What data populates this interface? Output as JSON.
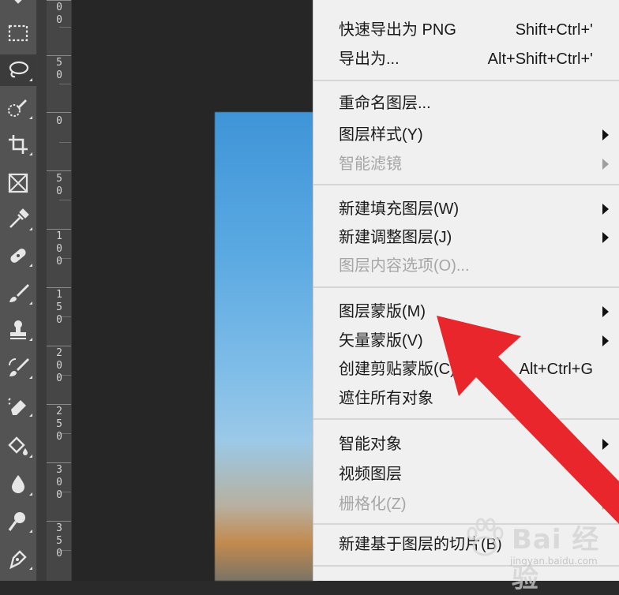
{
  "toolbar": {
    "tools": [
      {
        "icon": "move-icon"
      },
      {
        "icon": "rectangular-marquee-icon"
      },
      {
        "icon": "lasso-icon"
      },
      {
        "icon": "quick-selection-icon"
      },
      {
        "icon": "crop-icon"
      },
      {
        "icon": "frame-icon"
      },
      {
        "icon": "eyedropper-icon"
      },
      {
        "icon": "healing-brush-icon"
      },
      {
        "icon": "brush-icon"
      },
      {
        "icon": "clone-stamp-icon"
      },
      {
        "icon": "history-brush-icon"
      },
      {
        "icon": "eraser-icon"
      },
      {
        "icon": "paint-bucket-icon"
      },
      {
        "icon": "blur-icon"
      },
      {
        "icon": "dodge-icon"
      },
      {
        "icon": "pen-icon"
      }
    ],
    "active_tool": "lasso-icon"
  },
  "ruler": {
    "labels": [
      "0",
      "5\n0",
      "0",
      "5\n0",
      "1\n0\n0",
      "1\n5\n0",
      "2\n0\n0",
      "2\n5\n0",
      "3\n0\n0",
      "3\n5\n0"
    ],
    "top_partial": "0\n0"
  },
  "menu": {
    "items": [
      {
        "label": "快速导出为 PNG",
        "shortcut": "Shift+Ctrl+'",
        "enabled": true,
        "submenu": false
      },
      {
        "label": "导出为...",
        "shortcut": "Alt+Shift+Ctrl+'",
        "enabled": true,
        "submenu": false
      },
      {
        "label": "重命名图层...",
        "shortcut": "",
        "enabled": true,
        "submenu": false
      },
      {
        "label": "图层样式(Y)",
        "shortcut": "",
        "enabled": true,
        "submenu": true
      },
      {
        "label": "智能滤镜",
        "shortcut": "",
        "enabled": false,
        "submenu": true
      },
      {
        "label": "新建填充图层(W)",
        "shortcut": "",
        "enabled": true,
        "submenu": true
      },
      {
        "label": "新建调整图层(J)",
        "shortcut": "",
        "enabled": true,
        "submenu": true
      },
      {
        "label": "图层内容选项(O)...",
        "shortcut": "",
        "enabled": false,
        "submenu": false
      },
      {
        "label": "图层蒙版(M)",
        "shortcut": "",
        "enabled": true,
        "submenu": true
      },
      {
        "label": "矢量蒙版(V)",
        "shortcut": "",
        "enabled": true,
        "submenu": true
      },
      {
        "label": "创建剪贴蒙版(C)",
        "shortcut": "Alt+Ctrl+G",
        "enabled": true,
        "submenu": false
      },
      {
        "label": "遮住所有对象",
        "shortcut": "",
        "enabled": true,
        "submenu": false
      },
      {
        "label": "智能对象",
        "shortcut": "",
        "enabled": true,
        "submenu": true
      },
      {
        "label": "视频图层",
        "shortcut": "",
        "enabled": true,
        "submenu": true
      },
      {
        "label": "栅格化(Z)",
        "shortcut": "",
        "enabled": false,
        "submenu": true
      },
      {
        "label": "新建基于图层的切片(B)",
        "shortcut": "",
        "enabled": true,
        "submenu": false
      }
    ]
  },
  "annotation": {
    "arrow_color": "#e8262b",
    "points_to": "图层蒙版(M)"
  },
  "watermark": {
    "text": "Bai 经验",
    "sub": "jingyan.baidu.com"
  },
  "colors": {
    "toolbar_bg": "#535353",
    "ruler_bg": "#464646",
    "workspace_bg": "#262626",
    "menu_bg": "#f0f0f0",
    "disabled_text": "#a6a6a6"
  }
}
